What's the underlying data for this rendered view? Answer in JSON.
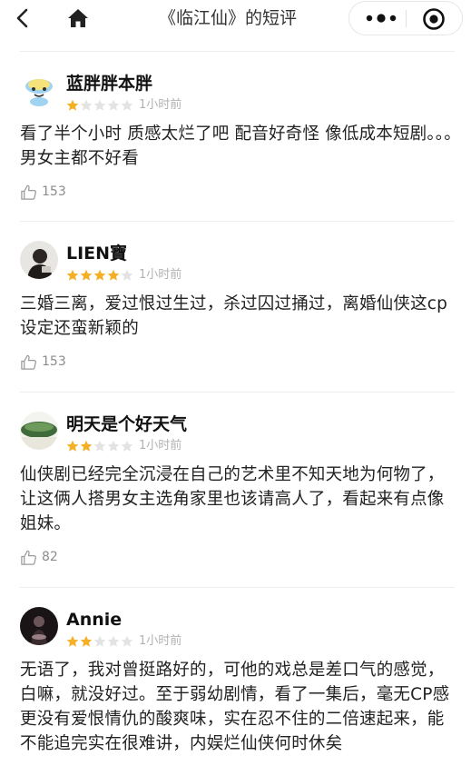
{
  "nav": {
    "title": "《临江仙》的短评",
    "back_icon": "chevron-left-icon",
    "home_icon": "home-icon",
    "more_icon": "more-dots-icon",
    "close_icon": "target-close-icon"
  },
  "reviews": [
    {
      "username": "蓝胖胖本胖",
      "rating": 1,
      "max_rating": 5,
      "time": "1小时前",
      "content": "看了半个小时 质感太烂了吧 配音好奇怪 像低成本短剧。。。男女主都不好看",
      "likes": "153"
    },
    {
      "username": "LIEN寶",
      "rating": 4,
      "max_rating": 5,
      "time": "1小时前",
      "content": "三婚三离，爱过恨过生过，杀过囚过捅过，离婚仙侠这cp设定还蛮新颖的",
      "likes": "153"
    },
    {
      "username": "明天是个好天气",
      "rating": 2,
      "max_rating": 5,
      "time": "1小时前",
      "content": "仙侠剧已经完全沉浸在自己的艺术里不知天地为何物了，让这俩人搭男女主选角家里也该请高人了，看起来有点像姐妹。",
      "likes": "82"
    },
    {
      "username": "Annie",
      "rating": 2,
      "max_rating": 5,
      "time": "1小时前",
      "content": "无语了，我对曾挺路好的，可他的戏总是差口气的感觉，白嘛，就没好过。至于弱幼剧情，看了一集后，毫无CP感更没有爱恨情仇的酸爽味，实在忍不住的二倍速起来，能不能追完实在很难讲，内娱烂仙侠何时休矣",
      "likes": ""
    }
  ],
  "colors": {
    "star_filled": "#f5b026",
    "star_empty": "#e3e3e3",
    "divider": "#ededed",
    "time_text": "#b2b2b2",
    "like_text": "#8c8c8c"
  }
}
